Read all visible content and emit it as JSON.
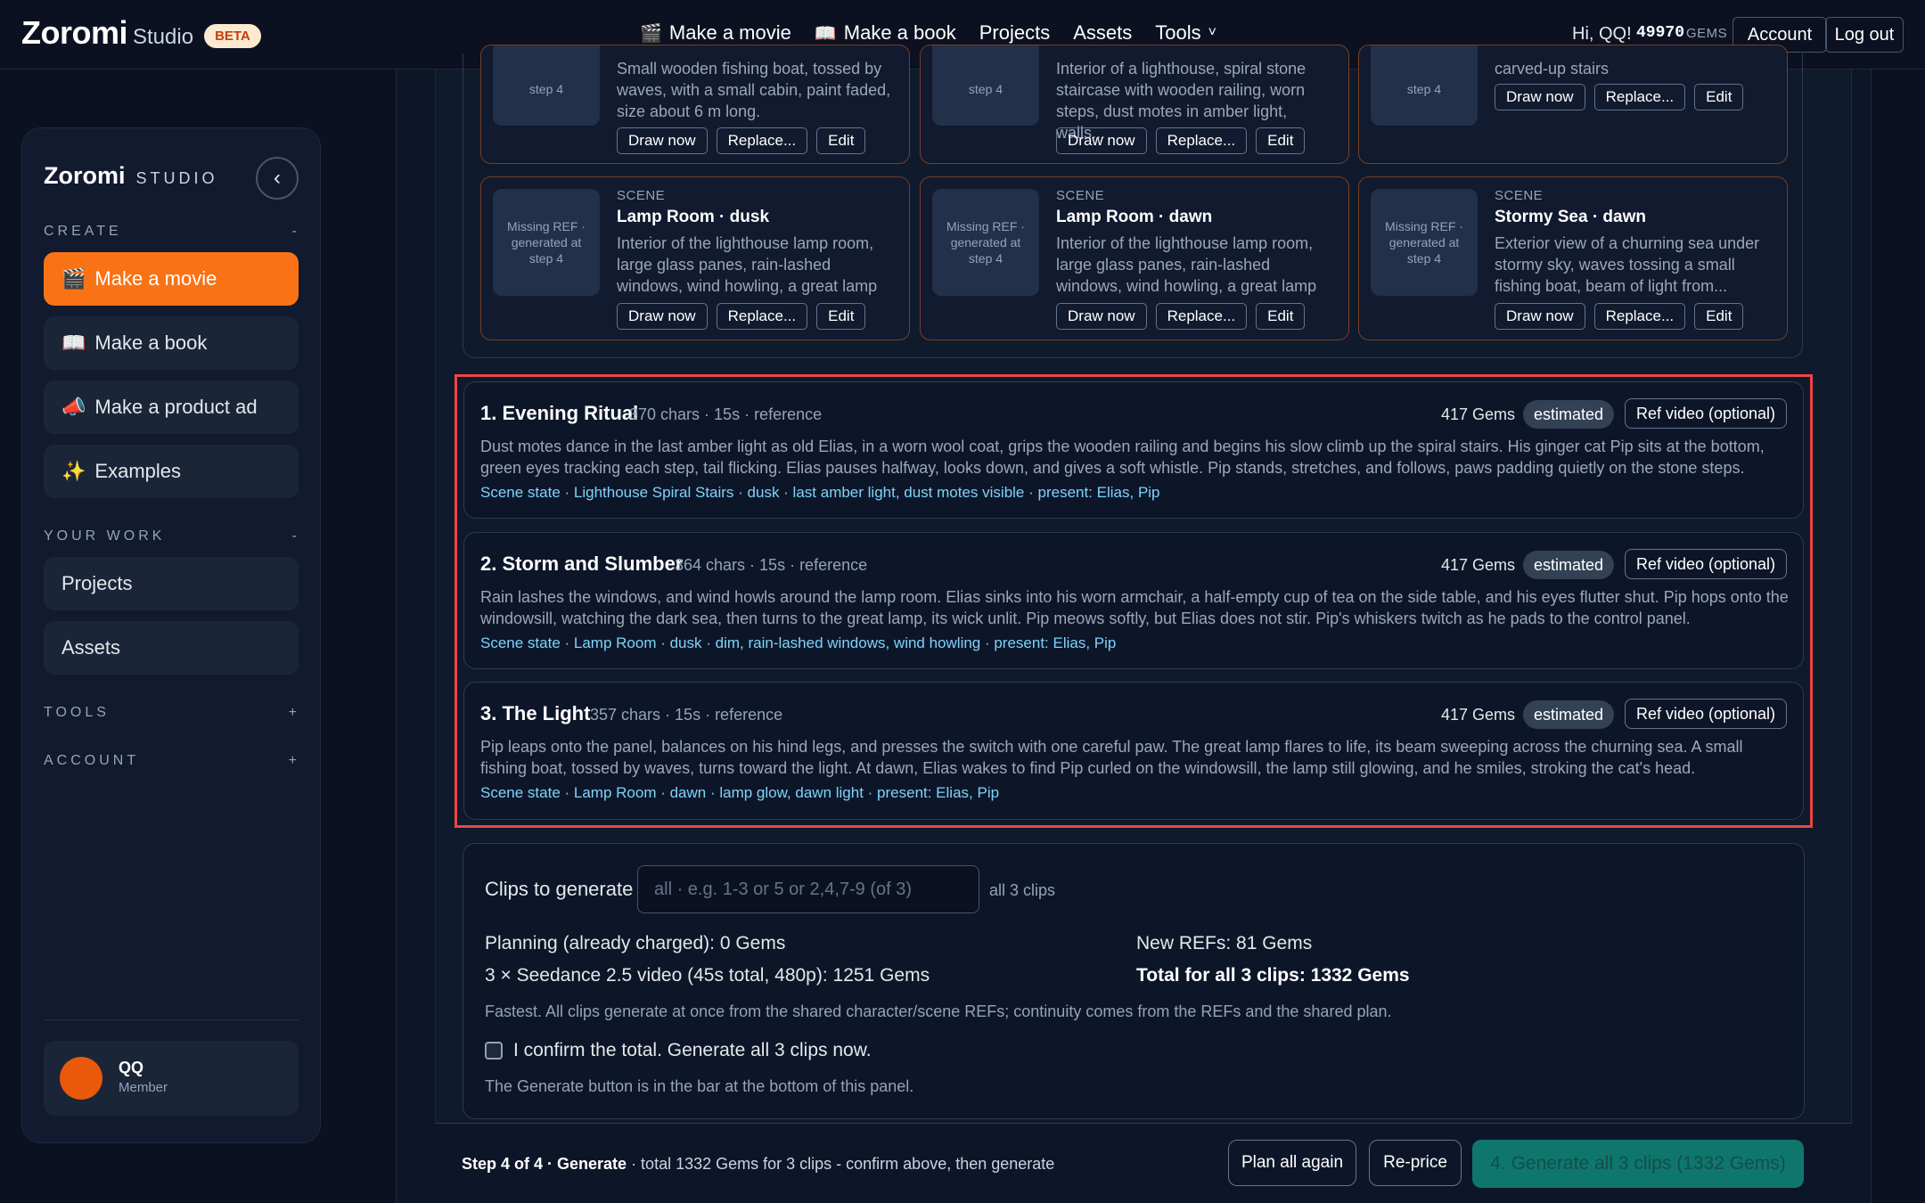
{
  "topbar": {
    "brand": "Zoromi",
    "brand_sub": "Studio",
    "beta": "BETA",
    "nav": [
      {
        "icon": "🎬",
        "label": "Make a movie"
      },
      {
        "icon": "📖",
        "label": "Make a book"
      },
      {
        "icon": "",
        "label": "Projects"
      },
      {
        "icon": "",
        "label": "Assets"
      },
      {
        "icon": "",
        "label": "Tools"
      }
    ],
    "tools_chevron": "˅",
    "greeting": "Hi, QQ!",
    "gems": "49970",
    "gems_unit": "GEMS",
    "account": "Account",
    "logout": "Log out"
  },
  "sidebar": {
    "title": "Zoromi",
    "subtitle": "STUDIO",
    "collapse": "‹",
    "create_label": "CREATE",
    "create_toggle": "-",
    "create_items": [
      {
        "icon": "🎬",
        "label": "Make a movie"
      },
      {
        "icon": "📖",
        "label": "Make a book"
      },
      {
        "icon": "📣",
        "label": "Make a product ad"
      },
      {
        "icon": "✨",
        "label": "Examples"
      }
    ],
    "work_label": "YOUR WORK",
    "work_toggle": "-",
    "work_items": [
      {
        "label": "Projects"
      },
      {
        "label": "Assets"
      }
    ],
    "tools_label": "TOOLS",
    "tools_toggle": "+",
    "account_label": "ACCOUNT",
    "account_toggle": "+",
    "user_name": "QQ",
    "user_role": "Member"
  },
  "refs": {
    "top_row": [
      {
        "thumb": "step 4",
        "desc": "Small wooden fishing boat, tossed by waves, with a small cabin, paint faded, size about 6 m long."
      },
      {
        "thumb": "step 4",
        "desc": "Interior of a lighthouse, spiral stone staircase with wooden railing, worn steps, dust motes in amber light, walls..."
      },
      {
        "thumb": "step 4",
        "desc": "carved-up stairs"
      }
    ],
    "bottom_row": [
      {
        "thumb": "Missing REF · generated at step 4",
        "kind": "SCENE",
        "name": "Lamp Room · dusk",
        "desc": "Interior of the lighthouse lamp room, large glass panes, rain-lashed windows, wind howling, a great lamp with unlit..."
      },
      {
        "thumb": "Missing REF · generated at step 4",
        "kind": "SCENE",
        "name": "Lamp Room · dawn",
        "desc": "Interior of the lighthouse lamp room, large glass panes, rain-lashed windows, wind howling, a great lamp with unlit..."
      },
      {
        "thumb": "Missing REF · generated at step 4",
        "kind": "SCENE",
        "name": "Stormy Sea · dawn",
        "desc": "Exterior view of a churning sea under stormy sky, waves tossing a small fishing boat, beam of light from..."
      }
    ],
    "draw_now": "Draw now",
    "replace": "Replace...",
    "edit": "Edit"
  },
  "clips": [
    {
      "title": "1. Evening Ritual",
      "meta": "370 chars · 15s · reference",
      "gems": "417 Gems",
      "estimated": "estimated",
      "ref_video": "Ref video (optional)",
      "desc": "Dust motes dance in the last amber light as old Elias, in a worn wool coat, grips the wooden railing and begins his slow climb up the spiral stairs. His ginger cat Pip sits at the bottom, green eyes tracking each step, tail flicking. Elias pauses halfway, looks down, and gives a soft whistle. Pip stands, stretches, and follows, paws padding quietly on the stone steps.",
      "state": "Scene state · Lighthouse Spiral Stairs · dusk · last amber light, dust motes visible · present: Elias, Pip"
    },
    {
      "title": "2. Storm and Slumber",
      "meta": "364 chars · 15s · reference",
      "gems": "417 Gems",
      "estimated": "estimated",
      "ref_video": "Ref video (optional)",
      "desc": "Rain lashes the windows, and wind howls around the lamp room. Elias sinks into his worn armchair, a half-empty cup of tea on the side table, and his eyes flutter shut. Pip hops onto the windowsill, watching the dark sea, then turns to the great lamp, its wick unlit. Pip meows softly, but Elias does not stir. Pip's whiskers twitch as he pads to the control panel.",
      "state": "Scene state · Lamp Room · dusk · dim, rain-lashed windows, wind howling · present: Elias, Pip"
    },
    {
      "title": "3. The Light",
      "meta": "357 chars · 15s · reference",
      "gems": "417 Gems",
      "estimated": "estimated",
      "ref_video": "Ref video (optional)",
      "desc": "Pip leaps onto the panel, balances on his hind legs, and presses the switch with one careful paw. The great lamp flares to life, its beam sweeping across the churning sea. A small fishing boat, tossed by waves, turns toward the light. At dawn, Elias wakes to find Pip curled on the windowsill, the lamp still glowing, and he smiles, stroking the cat's head.",
      "state": "Scene state · Lamp Room · dawn · lamp glow, dawn light · present: Elias, Pip"
    }
  ],
  "generate": {
    "label": "Clips to generate",
    "placeholder": "all · e.g. 1-3 or 5 or 2,4,7-9 (of 3)",
    "all_hint": "all 3 clips",
    "planning": "Planning (already charged): 0 Gems",
    "video": "3 × Seedance 2.5 video (45s total, 480p): 1251 Gems",
    "new_refs": "New REFs: 81 Gems",
    "total": "Total for all 3 clips: 1332 Gems",
    "note": "Fastest. All clips generate at once from the shared character/scene REFs; continuity comes from the REFs and the shared plan.",
    "confirm": "I confirm the total. Generate all 3 clips now.",
    "footer": "The Generate button is in the bar at the bottom of this panel."
  },
  "bottombar": {
    "step": "Step 4 of 4 · Generate",
    "step_rest": " · total 1332 Gems for 3 clips - confirm above, then generate",
    "plan_again": "Plan all again",
    "reprice": "Re-price",
    "generate_btn": "4. Generate all 3 clips (1332 Gems)"
  }
}
